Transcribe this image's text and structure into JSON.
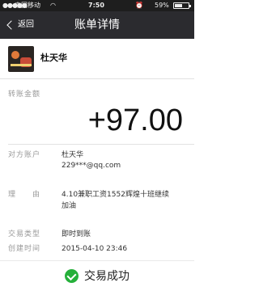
{
  "status_bar": {
    "carrier": "中国移动",
    "time": "7:50",
    "battery": "59%",
    "battery_level": 0.59,
    "icons": [
      "signal-icon",
      "wifi-icon",
      "alarm-icon",
      "battery-icon"
    ]
  },
  "nav": {
    "back_label": "返回",
    "title": "账单详情"
  },
  "payer": {
    "name": "杜天华"
  },
  "amount": {
    "label": "转账金额",
    "value": "+97.00"
  },
  "details": {
    "account_label": "对方账户",
    "account_name": "杜天华",
    "account_email": "229***@qq.com",
    "reason_label": "理　　由",
    "reason_line1": "4.10兼职工资1552辉煌十班继续",
    "reason_line2": "加油",
    "type_label": "交易类型",
    "type_value": "即时到账",
    "created_label": "创建时间",
    "created_value": "2015-04-10 23:46"
  },
  "footer": {
    "status": "交易成功",
    "accent_color": "#25b03a"
  }
}
